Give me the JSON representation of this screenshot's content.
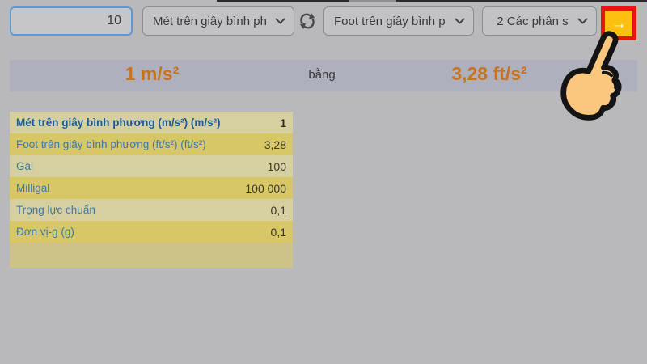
{
  "toolbar": {
    "input_value": "10",
    "from_unit_label": "Mét trên giây bình ph",
    "to_unit_label": "Foot trên giây bình p",
    "precision_label": "2 Các phân s",
    "convert_button_label": "→"
  },
  "result_bar": {
    "from_value": "1 m/s²",
    "equals_label": "bằng",
    "to_value": "3,28 ft/s²"
  },
  "table": {
    "rows": [
      {
        "label": "Mét trên giây bình phương (m/s²) (m/s²)",
        "value": "1"
      },
      {
        "label": "Foot trên giây bình phương (ft/s²) (ft/s²)",
        "value": "3,28"
      },
      {
        "label": "Gal",
        "value": "100"
      },
      {
        "label": "Milligal",
        "value": "100 000"
      },
      {
        "label": "Trọng lực chuẩn",
        "value": "0,1"
      },
      {
        "label": "Đơn vị-g (g)",
        "value": "0,1"
      }
    ]
  },
  "icons": {
    "swap": "swap-refresh-arrows",
    "chevron": "chevron-down",
    "hand": "pointing-hand-cursor"
  },
  "colors": {
    "page_background": "#b9b9bb",
    "result_bar_background": "#aeb1bd",
    "accent_orange": "#c9731c",
    "button_amber": "#fdc00f",
    "highlight_red": "#e8140d",
    "row_light": "#d6d0a0",
    "row_dark": "#d8c766",
    "link_blue": "#3c79b2",
    "input_border_blue": "#5b9bd5"
  }
}
